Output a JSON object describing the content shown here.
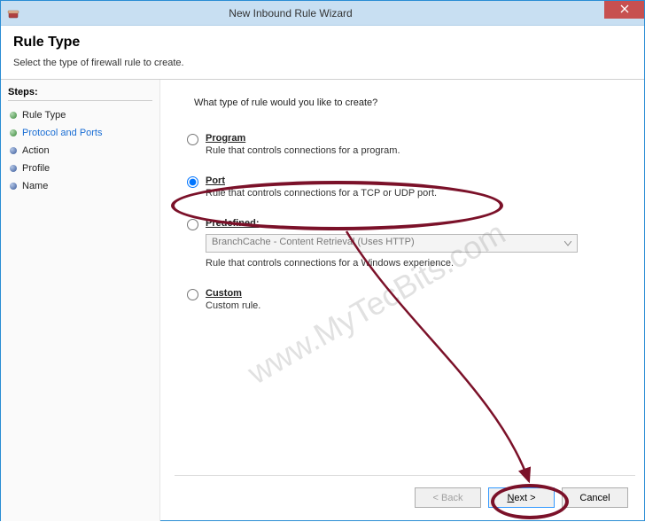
{
  "window": {
    "title": "New Inbound Rule Wizard"
  },
  "header": {
    "title": "Rule Type",
    "subtitle": "Select the type of firewall rule to create."
  },
  "sidebar": {
    "heading": "Steps:",
    "items": [
      {
        "label": "Rule Type",
        "active": false,
        "bullet": "green"
      },
      {
        "label": "Protocol and Ports",
        "active": true,
        "bullet": "green"
      },
      {
        "label": "Action",
        "active": false,
        "bullet": "blue"
      },
      {
        "label": "Profile",
        "active": false,
        "bullet": "blue"
      },
      {
        "label": "Name",
        "active": false,
        "bullet": "blue"
      }
    ]
  },
  "main": {
    "prompt": "What type of rule would you like to create?",
    "options": [
      {
        "id": "program",
        "title": "Program",
        "desc": "Rule that controls connections for a program.",
        "selected": false
      },
      {
        "id": "port",
        "title": "Port",
        "desc": "Rule that controls connections for a TCP or UDP port.",
        "selected": true
      },
      {
        "id": "predefined",
        "title": "Predefined:",
        "combo_value": "BranchCache - Content Retrieval (Uses HTTP)",
        "desc": "Rule that controls connections for a Windows experience.",
        "selected": false
      },
      {
        "id": "custom",
        "title": "Custom",
        "desc": "Custom rule.",
        "selected": false
      }
    ]
  },
  "buttons": {
    "back": "< Back",
    "next_prefix": "N",
    "next_rest": "ext >",
    "cancel": "Cancel"
  },
  "watermark": "www.MyTecBits.com",
  "annotation": {
    "color": "#7b1129"
  }
}
